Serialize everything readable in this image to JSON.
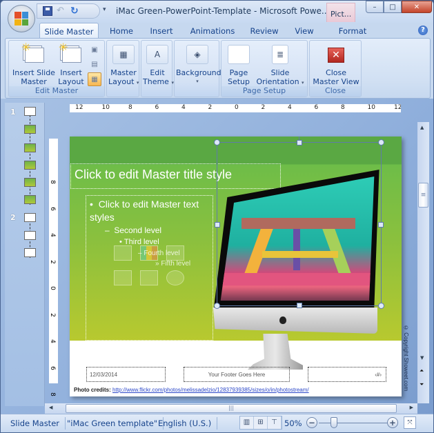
{
  "app": {
    "title": "iMac Green-PowerPoint-Template - Microsoft Powe...",
    "contextual_tab_header": "Pict...",
    "window_controls": {
      "minimize": "–",
      "maximize": "□",
      "close": "✕"
    }
  },
  "quick_access": {
    "save_icon": "save-icon",
    "undo_icon": "↶",
    "redo_icon": "↻",
    "more": "▾"
  },
  "tabs": [
    {
      "label": "Slide Master",
      "active": true
    },
    {
      "label": "Home"
    },
    {
      "label": "Insert"
    },
    {
      "label": "Animations"
    },
    {
      "label": "Review"
    },
    {
      "label": "View"
    },
    {
      "label": "Format"
    }
  ],
  "help_label": "?",
  "ribbon": {
    "edit_master": {
      "label": "Edit Master",
      "insert_slide_master": [
        "Insert Slide",
        "Master"
      ],
      "insert_layout": [
        "Insert",
        "Layout"
      ]
    },
    "master_layout": [
      "Master",
      "Layout"
    ],
    "edit_theme": [
      "Edit",
      "Theme"
    ],
    "background": "Background",
    "page_setup": {
      "label": "Page Setup",
      "page_setup_btn": [
        "Page",
        "Setup"
      ],
      "slide_orientation": [
        "Slide",
        "Orientation"
      ]
    },
    "close": {
      "label": "Close",
      "close_master_view": [
        "Close",
        "Master View"
      ],
      "close_glyph": "✕"
    },
    "dropdown_caret": "▾"
  },
  "thumbnails": {
    "master_numbers": [
      "1",
      "2"
    ]
  },
  "ruler": {
    "horizontal_labels": [
      "12",
      "10",
      "8",
      "6",
      "4",
      "2",
      "0",
      "2",
      "4",
      "6",
      "8",
      "10",
      "12"
    ],
    "vertical_labels": [
      "8",
      "6",
      "4",
      "2",
      "0",
      "2",
      "4",
      "6",
      "8"
    ]
  },
  "slide": {
    "title_placeholder": "Click to edit Master title style",
    "body": {
      "level1": "Click to edit Master text styles",
      "level2": "Second level",
      "level3": "Third level",
      "level4": "Fourth level",
      "level5": "Fifth level",
      "bullet1": "•",
      "bullet2": "–",
      "bullet3": "•",
      "bullet4": "–",
      "bullet5": "»"
    },
    "footer": {
      "date": "12/03/2014",
      "text": "Your Footer  Goes  Here",
      "slide_number": "‹#›"
    },
    "credits_label": "Photo credits:",
    "credits_url": "http://www.flickr.com/photos/melissadelzio/12837939385/sizes/o/in/photostream/",
    "copyright": "© Copyright Showeet.com",
    "colors": {
      "header_green": "#5aa843",
      "gradient_bottom": "#b8c92f"
    }
  },
  "statusbar": {
    "view": "Slide Master",
    "theme": "\"iMac Green template\"",
    "language": "English (U.S.)",
    "zoom": "50%",
    "zoom_out": "−",
    "zoom_in": "+"
  }
}
